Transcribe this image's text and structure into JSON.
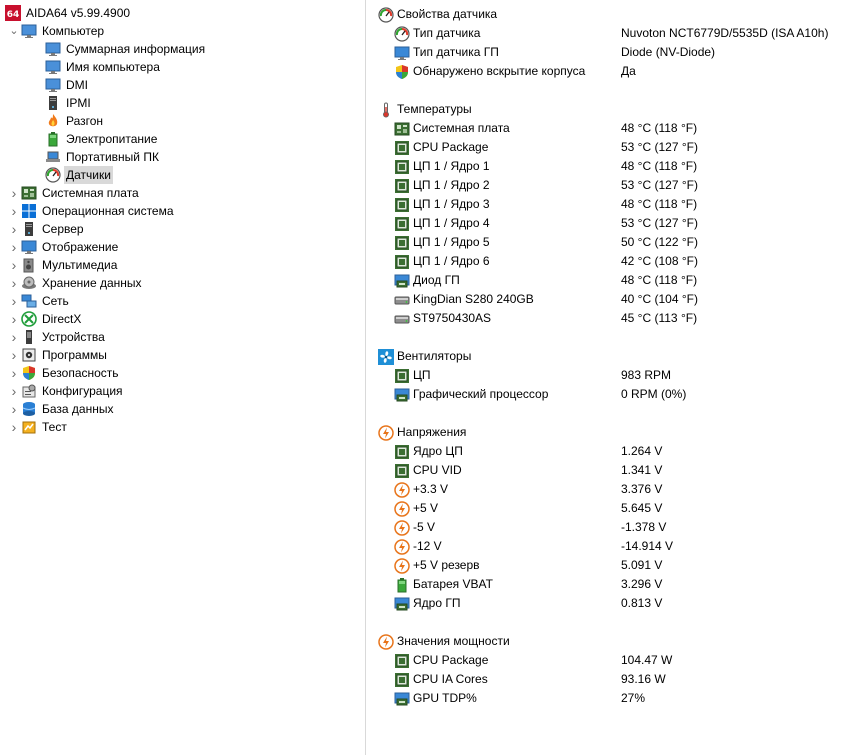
{
  "tree": {
    "root": {
      "label": "AIDA64 v5.99.4900",
      "icon": "aida64-logo-icon"
    },
    "computer": {
      "label": "Компьютер",
      "icon": "monitor-icon"
    },
    "computer_children": [
      {
        "label": "Суммарная информация",
        "icon": "monitor-icon",
        "name": "tree-item-summary"
      },
      {
        "label": "Имя компьютера",
        "icon": "monitor-icon",
        "name": "tree-item-computer-name"
      },
      {
        "label": "DMI",
        "icon": "monitor-icon",
        "name": "tree-item-dmi"
      },
      {
        "label": "IPMI",
        "icon": "server-tower-icon",
        "name": "tree-item-ipmi"
      },
      {
        "label": "Разгон",
        "icon": "flame-icon",
        "name": "tree-item-overclock"
      },
      {
        "label": "Электропитание",
        "icon": "battery-icon",
        "name": "tree-item-power"
      },
      {
        "label": "Портативный ПК",
        "icon": "laptop-icon",
        "name": "tree-item-portable-pc"
      },
      {
        "label": "Датчики",
        "icon": "gauge-icon",
        "name": "tree-item-sensors",
        "selected": true
      }
    ],
    "categories": [
      {
        "label": "Системная плата",
        "icon": "motherboard-icon",
        "name": "tree-item-motherboard"
      },
      {
        "label": "Операционная система",
        "icon": "windows-logo-icon",
        "name": "tree-item-os"
      },
      {
        "label": "Сервер",
        "icon": "server-tower-icon",
        "name": "tree-item-server"
      },
      {
        "label": "Отображение",
        "icon": "display-icon",
        "name": "tree-item-display"
      },
      {
        "label": "Мультимедиа",
        "icon": "speaker-icon",
        "name": "tree-item-multimedia"
      },
      {
        "label": "Хранение данных",
        "icon": "disk-icon",
        "name": "tree-item-storage"
      },
      {
        "label": "Сеть",
        "icon": "network-icon",
        "name": "tree-item-network"
      },
      {
        "label": "DirectX",
        "icon": "xbox-logo-icon",
        "name": "tree-item-directx"
      },
      {
        "label": "Устройства",
        "icon": "device-icon",
        "name": "tree-item-devices"
      },
      {
        "label": "Программы",
        "icon": "program-icon",
        "name": "tree-item-programs"
      },
      {
        "label": "Безопасность",
        "icon": "shield-icon",
        "name": "tree-item-security"
      },
      {
        "label": "Конфигурация",
        "icon": "config-icon",
        "name": "tree-item-config"
      },
      {
        "label": "База данных",
        "icon": "database-icon",
        "name": "tree-item-database"
      },
      {
        "label": "Тест",
        "icon": "benchmark-icon",
        "name": "tree-item-test"
      }
    ]
  },
  "sections": [
    {
      "title": "Свойства датчика",
      "icon": "gauge-icon",
      "name": "section-sensor-properties",
      "items": [
        {
          "label": "Тип датчика",
          "value": "Nuvoton NCT6779D/5535D  (ISA A10h)",
          "icon": "gauge-icon"
        },
        {
          "label": "Тип датчика ГП",
          "value": "Diode  (NV-Diode)",
          "icon": "display-icon"
        },
        {
          "label": "Обнаружено вскрытие корпуса",
          "value": "Да",
          "icon": "shield-icon"
        }
      ]
    },
    {
      "title": "Температуры",
      "icon": "thermometer-icon",
      "name": "section-temperatures",
      "items": [
        {
          "label": "Системная плата",
          "value": "48 °C  (118 °F)",
          "icon": "motherboard-icon"
        },
        {
          "label": "CPU Package",
          "value": "53 °C  (127 °F)",
          "icon": "chip-icon"
        },
        {
          "label": "ЦП 1 / Ядро 1",
          "value": "48 °C  (118 °F)",
          "icon": "chip-icon"
        },
        {
          "label": "ЦП 1 / Ядро 2",
          "value": "53 °C  (127 °F)",
          "icon": "chip-icon"
        },
        {
          "label": "ЦП 1 / Ядро 3",
          "value": "48 °C  (118 °F)",
          "icon": "chip-icon"
        },
        {
          "label": "ЦП 1 / Ядро 4",
          "value": "53 °C  (127 °F)",
          "icon": "chip-icon"
        },
        {
          "label": "ЦП 1 / Ядро 5",
          "value": "50 °C  (122 °F)",
          "icon": "chip-icon"
        },
        {
          "label": "ЦП 1 / Ядро 6",
          "value": "42 °C  (108 °F)",
          "icon": "chip-icon"
        },
        {
          "label": "Диод ГП",
          "value": "48 °C  (118 °F)",
          "icon": "gpu-icon"
        },
        {
          "label": "KingDian S280 240GB",
          "value": "40 °C  (104 °F)",
          "icon": "drive-icon"
        },
        {
          "label": "ST9750430AS",
          "value": "45 °C  (113 °F)",
          "icon": "drive-icon"
        }
      ]
    },
    {
      "title": "Вентиляторы",
      "icon": "fan-icon",
      "name": "section-fans",
      "items": [
        {
          "label": "ЦП",
          "value": "983 RPM",
          "icon": "chip-icon"
        },
        {
          "label": "Графический процессор",
          "value": "0 RPM  (0%)",
          "icon": "gpu-icon"
        }
      ]
    },
    {
      "title": "Напряжения",
      "icon": "voltage-icon",
      "name": "section-voltages",
      "items": [
        {
          "label": "Ядро ЦП",
          "value": "1.264 V",
          "icon": "chip-icon"
        },
        {
          "label": "CPU VID",
          "value": "1.341 V",
          "icon": "chip-icon"
        },
        {
          "label": "+3.3 V",
          "value": "3.376 V",
          "icon": "voltage-icon"
        },
        {
          "label": "+5 V",
          "value": "5.645 V",
          "icon": "voltage-icon"
        },
        {
          "label": "-5 V",
          "value": "-1.378 V",
          "icon": "voltage-icon"
        },
        {
          "label": "-12 V",
          "value": "-14.914 V",
          "icon": "voltage-icon"
        },
        {
          "label": "+5 V резерв",
          "value": "5.091 V",
          "icon": "voltage-icon"
        },
        {
          "label": "Батарея VBAT",
          "value": "3.296 V",
          "icon": "battery-icon"
        },
        {
          "label": "Ядро ГП",
          "value": "0.813 V",
          "icon": "gpu-icon"
        }
      ]
    },
    {
      "title": "Значения мощности",
      "icon": "voltage-icon",
      "name": "section-power",
      "items": [
        {
          "label": "CPU Package",
          "value": "104.47 W",
          "icon": "chip-icon"
        },
        {
          "label": "CPU IA Cores",
          "value": "93.16 W",
          "icon": "chip-icon"
        },
        {
          "label": "GPU TDP%",
          "value": "27%",
          "icon": "gpu-icon"
        }
      ]
    }
  ],
  "colors": {
    "selection": "#d9d9d9",
    "chip_green": "#3b6e32",
    "voltage_orange": "#e8741a",
    "fan_blue": "#1f8fd6"
  }
}
